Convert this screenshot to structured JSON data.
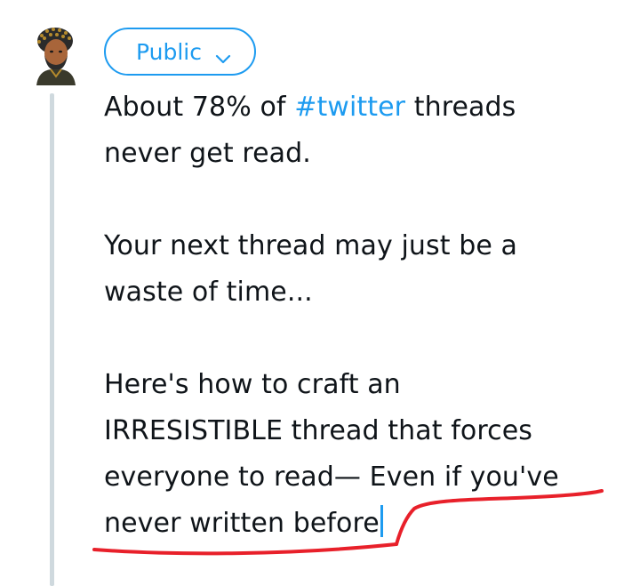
{
  "composer": {
    "audience_label": "Public",
    "text": {
      "line1_pre": "About 78% of ",
      "line1_hashtag": "#twitter",
      "line1_post": " threads",
      "line2": "never get read.",
      "line3": "Your next thread may just be a",
      "line4": "waste of time...",
      "line5": "Here's how to craft an",
      "line6": "IRRESISTIBLE thread that forces",
      "line7": "everyone to read— Even if you've",
      "line8": "never written before"
    }
  },
  "colors": {
    "accent": "#1d9bf0",
    "text": "#0f1419",
    "thread_line": "#cfd9de",
    "annotation": "#e8202a"
  },
  "icons": {
    "audience_dropdown": "chevron-down-icon",
    "avatar": "avatar"
  }
}
